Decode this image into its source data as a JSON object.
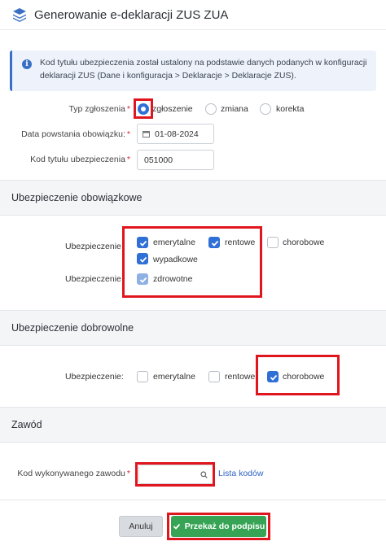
{
  "header": {
    "title": "Generowanie e-deklaracji ZUS ZUA",
    "icon": "layers-icon"
  },
  "info": {
    "icon": "info-icon",
    "text": "Kod tytułu ubezpieczenia został ustalony na podstawie danych podanych w konfiguracji deklaracji ZUS (Dane i konfiguracja > Deklaracje > Deklaracje ZUS)."
  },
  "form": {
    "typ_label": "Typ zgłoszenia",
    "typ_options": [
      "zgłoszenie",
      "zmiana",
      "korekta"
    ],
    "typ_selected": "zgłoszenie",
    "data_label": "Data powstania obowiązku:",
    "data_value": "01-08-2024",
    "kod_label": "Kod tytułu ubezpieczenia",
    "kod_value": "051000",
    "required_mark": "*"
  },
  "obowiazkowe": {
    "title": "Ubezpieczenie obowiązkowe",
    "row1_label": "Ubezpieczenie",
    "row2_label": "Ubezpieczenie",
    "items": [
      {
        "label": "emerytalne",
        "checked": true
      },
      {
        "label": "rentowe",
        "checked": true
      },
      {
        "label": "chorobowe",
        "checked": false
      },
      {
        "label": "wypadkowe",
        "checked": true
      },
      {
        "label": "zdrowotne",
        "checked": true,
        "disabled": true
      }
    ]
  },
  "dobrowolne": {
    "title": "Ubezpieczenie dobrowolne",
    "row_label": "Ubezpieczenie:",
    "items": [
      {
        "label": "emerytalne",
        "checked": false
      },
      {
        "label": "rentowe",
        "checked": false
      },
      {
        "label": "chorobowe",
        "checked": true
      }
    ]
  },
  "zawod": {
    "title": "Zawód",
    "label": "Kod wykonywanego zawodu",
    "value": "",
    "link": "Lista kodów"
  },
  "footer": {
    "cancel": "Anuluj",
    "submit": "Przekaż do podpisu"
  },
  "colors": {
    "accent": "#2f6fd6",
    "highlight": "#e0161f",
    "submit": "#37a455",
    "required": "#d9232d"
  }
}
